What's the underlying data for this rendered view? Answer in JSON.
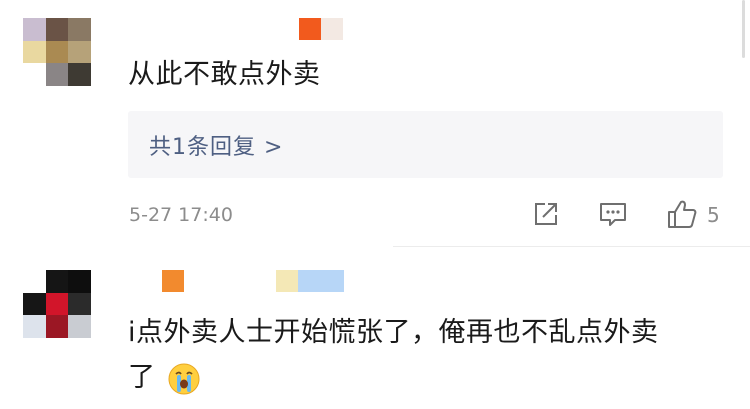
{
  "comments": [
    {
      "text": "从此不敢点外卖",
      "reply_link": "共1条回复 >",
      "timestamp": "5-27 17:40",
      "like_count": "5"
    },
    {
      "text_line1": "i点外卖人士开始慌张了，俺再也不乱点外卖",
      "text_line2": "了"
    }
  ],
  "icons": {
    "share": "share-icon",
    "comment": "comment-icon",
    "like": "thumbs-up-icon",
    "emoji": "crying-face-icon"
  },
  "colors": {
    "link": "#4e5f82",
    "muted": "#8c8c8c",
    "reply_bg": "#f6f6f8"
  }
}
